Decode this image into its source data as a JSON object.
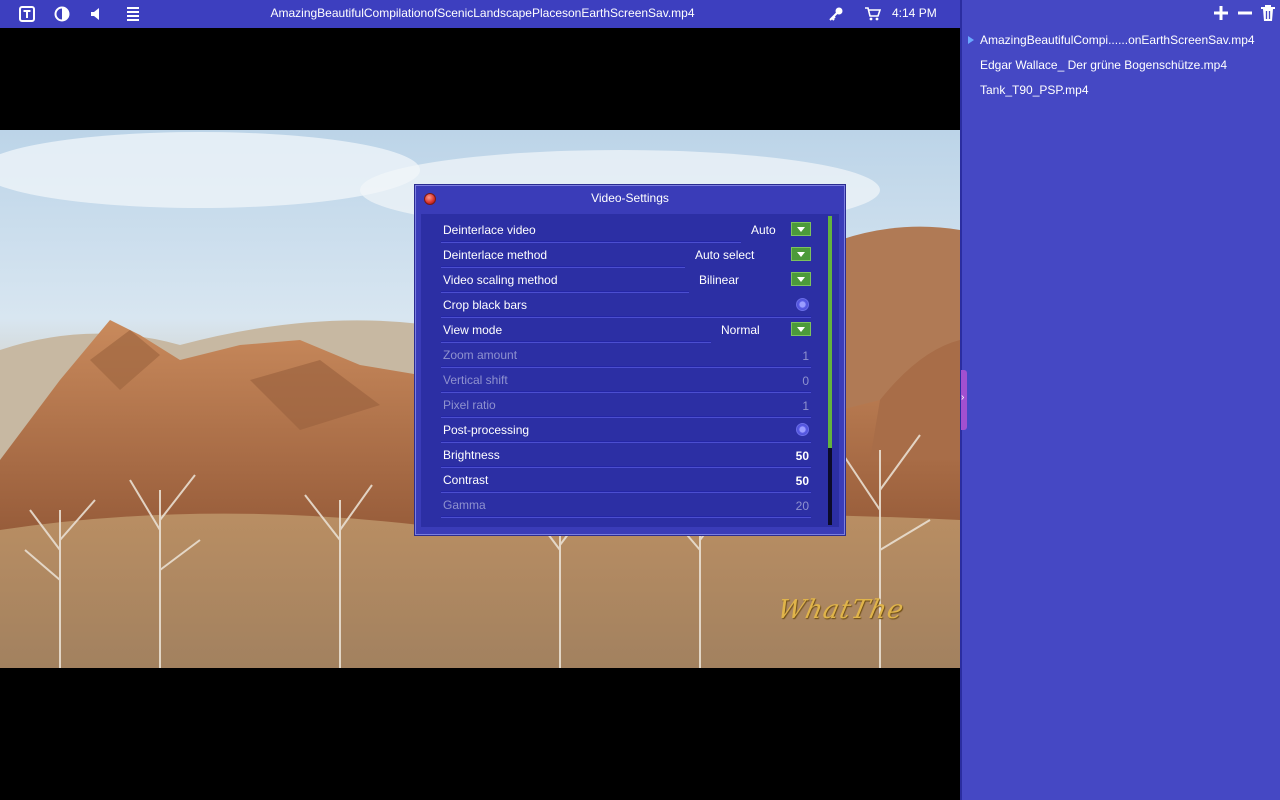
{
  "topbar": {
    "title": "AmazingBeautifulCompilationofScenicLandscapePlacesonEarthScreenSav.mp4",
    "clock": "4:14 PM",
    "icons": [
      "subtitle-icon",
      "contrast-icon",
      "volume-icon",
      "playlist-icon",
      "key-icon",
      "cart-icon"
    ]
  },
  "video": {
    "watermark": "WhatThe"
  },
  "dialog": {
    "title": "Video-Settings",
    "rows": [
      {
        "label": "Deinterlace video",
        "type": "select",
        "value": "Auto",
        "enabled": true
      },
      {
        "label": "Deinterlace method",
        "type": "select",
        "value": "Auto select",
        "enabled": true
      },
      {
        "label": "Video scaling method",
        "type": "select",
        "value": "Bilinear",
        "enabled": true
      },
      {
        "label": "Crop black bars",
        "type": "radio",
        "value": "",
        "enabled": true
      },
      {
        "label": "View mode",
        "type": "select",
        "value": "Normal",
        "enabled": true
      },
      {
        "label": "Zoom amount",
        "type": "number",
        "value": "1",
        "enabled": false
      },
      {
        "label": "Vertical shift",
        "type": "number",
        "value": "0",
        "enabled": false
      },
      {
        "label": "Pixel ratio",
        "type": "number",
        "value": "1",
        "enabled": false
      },
      {
        "label": "Post-processing",
        "type": "radio",
        "value": "",
        "enabled": true
      },
      {
        "label": "Brightness",
        "type": "number",
        "value": "50",
        "enabled": true
      },
      {
        "label": "Contrast",
        "type": "number",
        "value": "50",
        "enabled": true
      },
      {
        "label": "Gamma",
        "type": "number",
        "value": "20",
        "enabled": false
      }
    ],
    "scroll_position": 0,
    "scroll_visible_fraction": 0.75
  },
  "playlist": {
    "buttons": [
      "add-icon",
      "remove-icon",
      "trash-icon"
    ],
    "items": [
      {
        "label": "AmazingBeautifulCompi......onEarthScreenSav.mp4",
        "current": true
      },
      {
        "label": "Edgar Wallace_ Der grüne Bogenschütze.mp4",
        "current": false
      },
      {
        "label": "Tank_T90_PSP.mp4",
        "current": false
      }
    ],
    "handle_glyph": "›"
  },
  "colors": {
    "bar": "#3d3fbf",
    "panel": "#4548c4",
    "dialog": "#3a3cb8",
    "dropdown": "#4c9a3a",
    "scroll_thumb": "#63b33e"
  }
}
